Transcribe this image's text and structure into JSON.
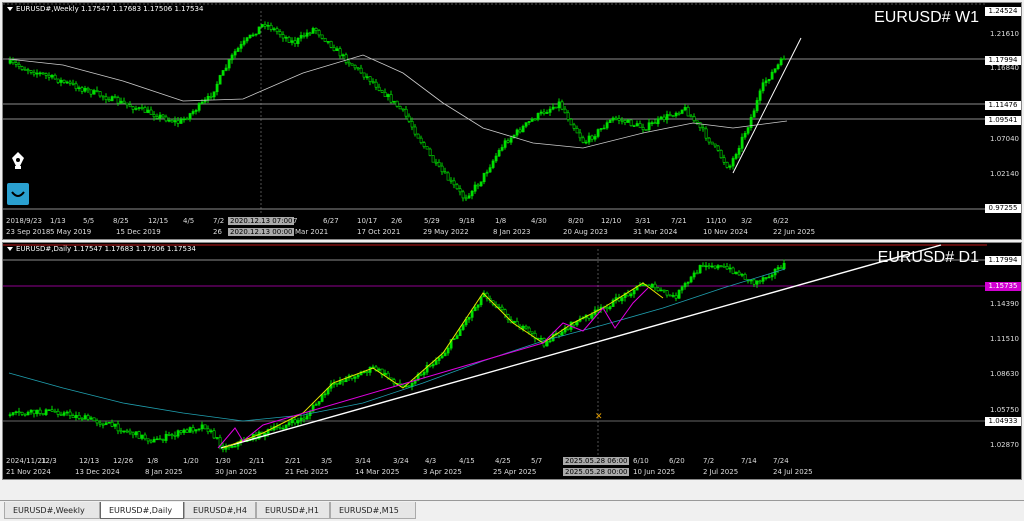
{
  "weekly": {
    "header": "EURUSD#,Weekly  1.17547 1.17683 1.17506 1.17534",
    "big_label": "EURUSD# W1",
    "price_labels": [
      "1.21610",
      "1.16840",
      "1.07040",
      "1.02140"
    ],
    "price_boxes": [
      "1.24524",
      "1.17994",
      "1.11476",
      "1.09541",
      "0.97255"
    ],
    "time_top": [
      "2018/9/23",
      "1/13",
      "5/5",
      "8/25",
      "12/15",
      "4/5",
      "7/2",
      "2020.12.13 07:00",
      "7",
      "6/27",
      "10/17",
      "2/6",
      "5/29",
      "9/18",
      "1/8",
      "4/30",
      "8/20",
      "12/10",
      "3/31",
      "7/21",
      "11/10",
      "3/2",
      "6/22"
    ],
    "time_bottom": [
      "23 Sep 2018",
      "5 May 2019",
      "15 Dec 2019",
      "26",
      "2020.12.13 00:00",
      "Mar 2021",
      "17 Oct 2021",
      "29 May 2022",
      "8 Jan 2023",
      "20 Aug 2023",
      "31 Mar 2024",
      "10 Nov 2024",
      "22 Jun 2025"
    ]
  },
  "daily": {
    "header": "EURUSD#,Daily  1.17547 1.17683 1.17506 1.17534",
    "big_label": "EURUSD# D1",
    "price_labels": [
      "1.14390",
      "1.11510",
      "1.08630",
      "1.05750",
      "1.02870"
    ],
    "price_boxes": [
      "1.17994",
      "1.15735",
      "1.04933"
    ],
    "time_top": [
      "2024/11/21",
      "12/3",
      "12/13",
      "12/26",
      "1/8",
      "1/20",
      "1/30",
      "2/11",
      "2/21",
      "3/5",
      "3/14",
      "3/24",
      "4/3",
      "4/15",
      "4/25",
      "5/7",
      "2025.05.28 06:00",
      "6/10",
      "6/20",
      "7/2",
      "7/14",
      "7/24"
    ],
    "time_bottom": [
      "21 Nov 2024",
      "13 Dec 2024",
      "8 Jan 2025",
      "30 Jan 2025",
      "21 Feb 2025",
      "14 Mar 2025",
      "3 Apr 2025",
      "25 Apr 2025",
      "2025.05.28 00:00",
      "10 Jun 2025",
      "2 Jul 2025",
      "24 Jul 2025"
    ]
  },
  "tabs": [
    "EURUSD#,Weekly",
    "EURUSD#,Daily",
    "EURUSD#,H4",
    "EURUSD#,H1",
    "EURUSD#,M15"
  ],
  "active_tab": 1,
  "colors": {
    "candle": "#00e000",
    "ma_white": "#cccccc",
    "ma_cyan": "#1fa0b0",
    "trend": "#ffffff",
    "zigzag_yellow": "#e6e600",
    "zigzag_magenta": "#e000e0",
    "hline_red": "#ff2020",
    "hline_magenta": "#c000c0"
  },
  "icons": [
    "pen-tool-icon",
    "smile-tool-icon"
  ]
}
